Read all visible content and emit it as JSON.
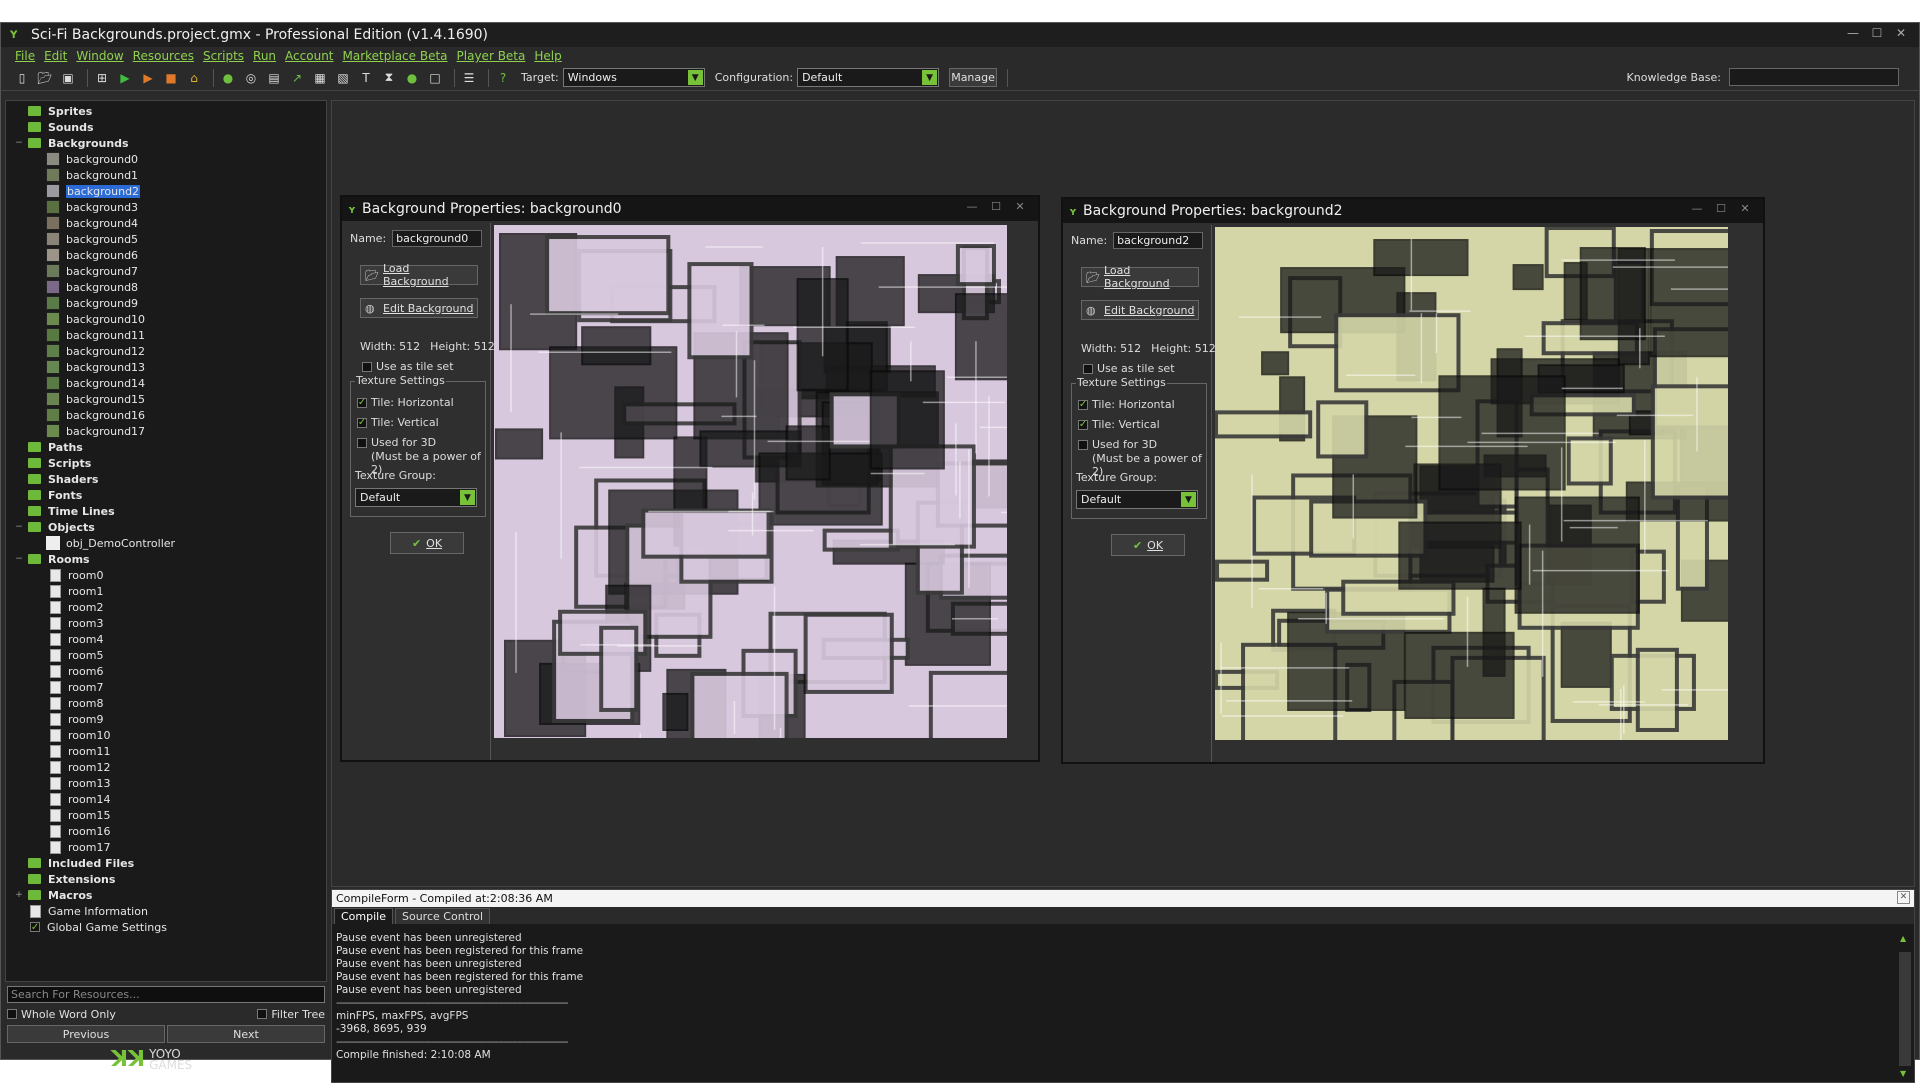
{
  "window": {
    "title": "Sci-Fi Backgrounds.project.gmx  -  Professional Edition (v1.4.1690)",
    "controls": [
      "—",
      "☐",
      "✕"
    ]
  },
  "menu": [
    "File",
    "Edit",
    "Window",
    "Resources",
    "Scripts",
    "Run",
    "Account",
    "Marketplace Beta",
    "Player Beta",
    "Help"
  ],
  "toolbar": {
    "target_label": "Target:",
    "target_value": "Windows",
    "config_label": "Configuration:",
    "config_value": "Default",
    "manage_label": "Manage",
    "kb_label": "Knowledge Base:"
  },
  "tree": {
    "top_groups": [
      "Sprites",
      "Sounds"
    ],
    "backgrounds_label": "Backgrounds",
    "backgrounds": [
      "background0",
      "background1",
      "background2",
      "background3",
      "background4",
      "background5",
      "background6",
      "background7",
      "background8",
      "background9",
      "background10",
      "background11",
      "background12",
      "background13",
      "background14",
      "background15",
      "background16",
      "background17"
    ],
    "selected_background": "background2",
    "mid_groups": [
      "Paths",
      "Scripts",
      "Shaders",
      "Fonts",
      "Time Lines"
    ],
    "objects_label": "Objects",
    "objects": [
      "obj_DemoController"
    ],
    "rooms_label": "Rooms",
    "rooms": [
      "room0",
      "room1",
      "room2",
      "room3",
      "room4",
      "room5",
      "room6",
      "room7",
      "room8",
      "room9",
      "room10",
      "room11",
      "room12",
      "room13",
      "room14",
      "room15",
      "room16",
      "room17"
    ],
    "bottom_groups": [
      "Included Files",
      "Extensions",
      "Macros"
    ],
    "extra_items": [
      "Game Information",
      "Global Game Settings"
    ]
  },
  "search": {
    "placeholder": "Search For Resources...",
    "whole_word": "Whole Word Only",
    "filter_tree": "Filter Tree",
    "previous": "Previous",
    "next": "Next"
  },
  "brand": {
    "line1": "YOYO",
    "line2": "GAMES",
    "green": "#78c23a"
  },
  "bg_windows": [
    {
      "title": "Background Properties: background0",
      "name_label": "Name:",
      "name_value": "background0",
      "load_label": "Load Background",
      "edit_label": "Edit Background",
      "width_label": "Width:",
      "width_value": "512",
      "height_label": "Height:",
      "height_value": "512",
      "tileset_label": "Use as tile set",
      "texture_settings": "Texture Settings",
      "tile_h": "Tile: Horizontal",
      "tile_v": "Tile: Vertical",
      "used_3d": "Used for 3D",
      "power2": "(Must be a power of 2)",
      "group_label": "Texture Group:",
      "group_value": "Default",
      "ok_label": "OK",
      "texture_tint": "#d8c8de"
    },
    {
      "title": "Background Properties: background2",
      "name_label": "Name:",
      "name_value": "background2",
      "load_label": "Load Background",
      "edit_label": "Edit Background",
      "width_label": "Width:",
      "width_value": "512",
      "height_label": "Height:",
      "height_value": "512",
      "tileset_label": "Use as tile set",
      "texture_settings": "Texture Settings",
      "tile_h": "Tile: Horizontal",
      "tile_v": "Tile: Vertical",
      "used_3d": "Used for 3D",
      "power2": "(Must be a power of 2)",
      "group_label": "Texture Group:",
      "group_value": "Default",
      "ok_label": "OK",
      "texture_tint": "#d4d6a8"
    }
  ],
  "compile": {
    "header": "CompileForm - Compiled at:2:08:36 AM",
    "tabs": [
      "Compile",
      "Source Control"
    ],
    "log": [
      "Pause event has been unregistered",
      "Pause event has been registered for this frame",
      "Pause event has been unregistered",
      "Pause event has been registered for this frame",
      "Pause event has been unregistered",
      "-----------------------------------------------------------------------------------",
      "minFPS, maxFPS, avgFPS",
      "-3968, 8695, 939",
      "-----------------------------------------------------------------------------------",
      "Compile finished: 2:10:08 AM"
    ]
  }
}
